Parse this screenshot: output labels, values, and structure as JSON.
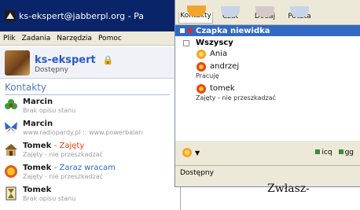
{
  "win1": {
    "title": "ks-ekspert@jabberpl.org - Pa",
    "menu": [
      "Plik",
      "Zadania",
      "Narzędzia",
      "Pomoc"
    ],
    "profile": {
      "name": "ks-ekspert",
      "status": "Dostępny"
    },
    "section": "Kontakty",
    "contacts": [
      {
        "name": "Marcin",
        "state": "",
        "desc": "Brak opisu stanu",
        "icon": "flower-icon"
      },
      {
        "name": "Marcin",
        "state": "",
        "desc": "www.radiopardy.pl :: www.powerbalan",
        "icon": "butterfly-icon"
      },
      {
        "name": "Tomek",
        "state": "- Zajęty",
        "desc": "Zajęty - nie przeszkadzać",
        "icon": "house-icon"
      },
      {
        "name": "Tomek",
        "state": "- Zaraz wracam",
        "desc": "Zajęty - nie przeszkadzać",
        "icon": "sun-icon"
      },
      {
        "name": "Tomek",
        "state": "",
        "desc": "Brak opisu stanu",
        "icon": "hourglass-icon"
      }
    ]
  },
  "win2": {
    "toolbar": [
      "Kontakty",
      "Czat",
      "Dodaj",
      "Poczta"
    ],
    "group": "Czapka niewidka",
    "subgroup": "Wszyscy",
    "contacts": [
      {
        "name": "Ania",
        "desc": ""
      },
      {
        "name": "andrzej",
        "desc": "Pracuję"
      },
      {
        "name": "tomek",
        "desc": "Zajęty - nie przeszkadzać"
      }
    ],
    "networks": [
      "icq",
      "gg"
    ],
    "status": "Dostępny"
  },
  "article_text": "Zwłasz-",
  "colors": {
    "accent": "#316ac5",
    "title_bar": "#0a246a",
    "contact_state": "#e04010",
    "section": "#4f78c6"
  }
}
